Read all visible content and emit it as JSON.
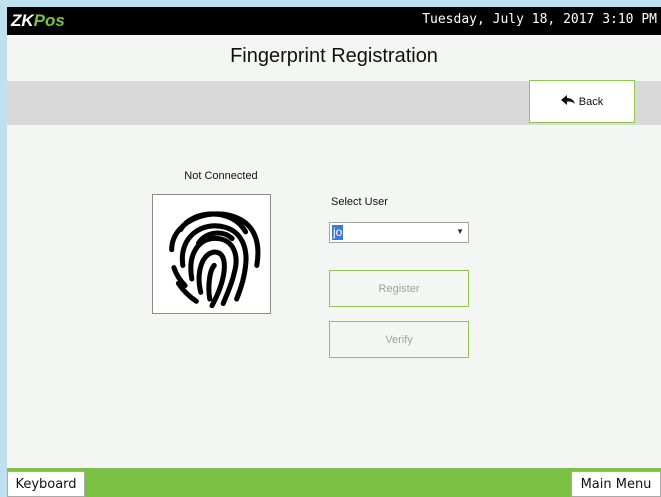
{
  "header": {
    "logo_zk": "ZK",
    "logo_pos": "Pos",
    "datetime": "Tuesday, July 18, 2017 3:10 PM"
  },
  "page": {
    "title": "Fingerprint Registration"
  },
  "toolbar": {
    "back_label": "Back",
    "back_icon": "back-arrow-icon"
  },
  "scanner": {
    "status": "Not Connected",
    "icon": "fingerprint-icon"
  },
  "form": {
    "select_user_label": "Select User",
    "selected_user": "jo",
    "register_label": "Register",
    "verify_label": "Verify"
  },
  "footer": {
    "keyboard_label": "Keyboard",
    "main_menu_label": "Main Menu"
  },
  "colors": {
    "accent_green": "#7ac143",
    "title_bar": "#000000",
    "selection_blue": "#3b78d8"
  }
}
